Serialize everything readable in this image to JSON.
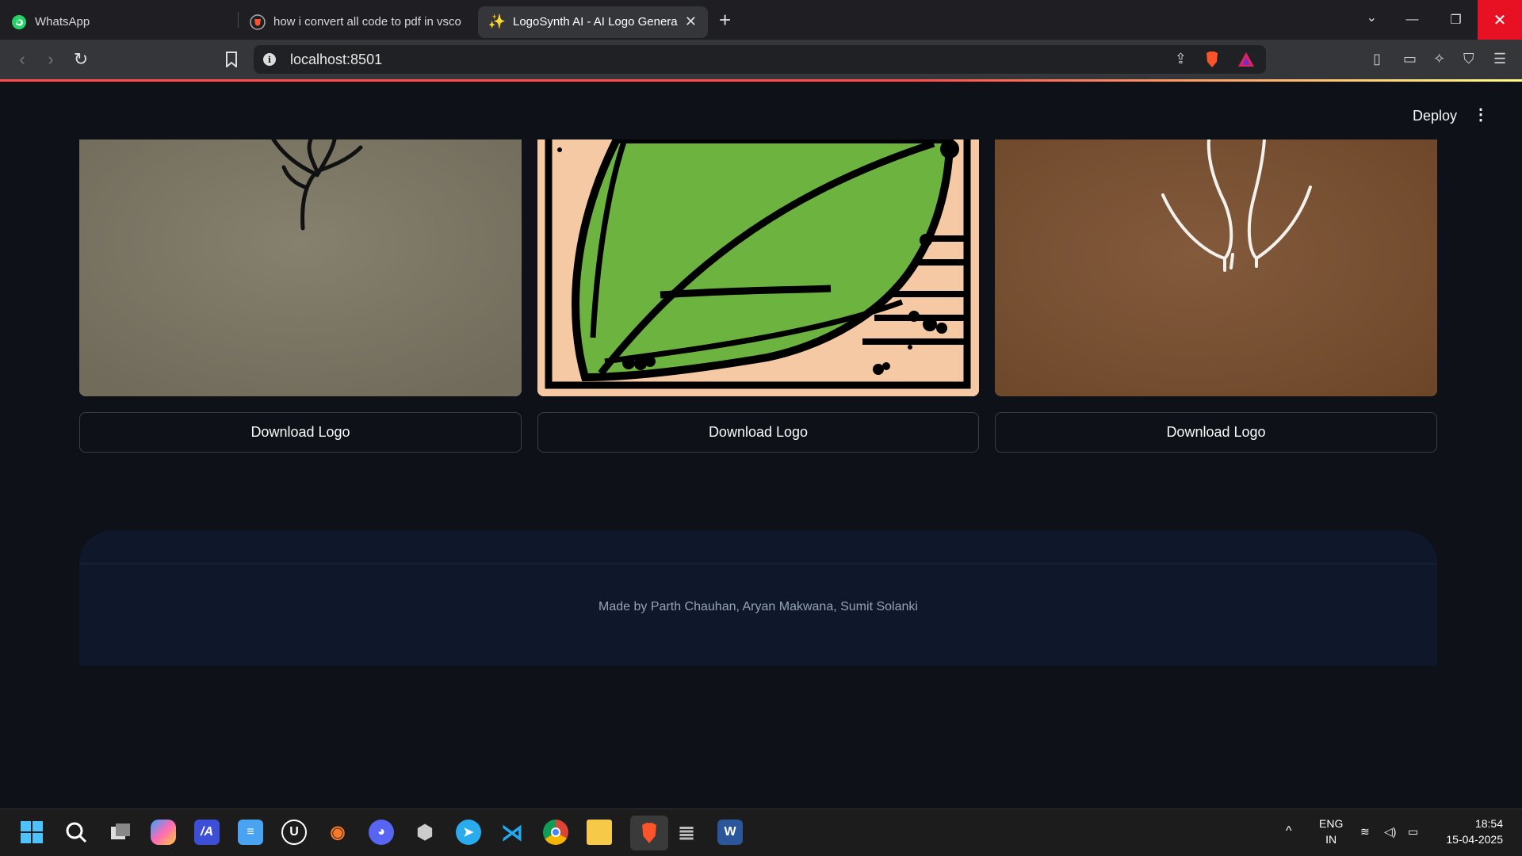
{
  "browser": {
    "tabs": [
      {
        "title": "WhatsApp",
        "icon": "whatsapp-icon",
        "active": false
      },
      {
        "title": "how i convert all code to pdf in vsco",
        "icon": "brave-search-icon",
        "active": false
      },
      {
        "title": "LogoSynth AI - AI Logo Genera",
        "icon": "sparkles-icon",
        "active": true
      }
    ],
    "new_tab": "+",
    "url": "localhost:8501"
  },
  "app": {
    "deploy_label": "Deploy",
    "menu_label": "⋮",
    "logos": [
      {
        "name": "logo-1",
        "background": "#7f7866",
        "download_label": "Download Logo"
      },
      {
        "name": "logo-2",
        "background": "#f6c9a5",
        "download_label": "Download Logo"
      },
      {
        "name": "logo-3",
        "background": "#7c5236",
        "download_label": "Download Logo"
      }
    ],
    "footer_text": "Made by Parth Chauhan, Aryan Makwana, Sumit Solanki"
  },
  "taskbar": {
    "language": "ENG",
    "region": "IN",
    "time": "18:54",
    "date": "15-04-2025"
  },
  "colors": {
    "page_bg": "#0e1117",
    "footer_bg": "#0f172a",
    "accent": "#ff4b4b"
  }
}
